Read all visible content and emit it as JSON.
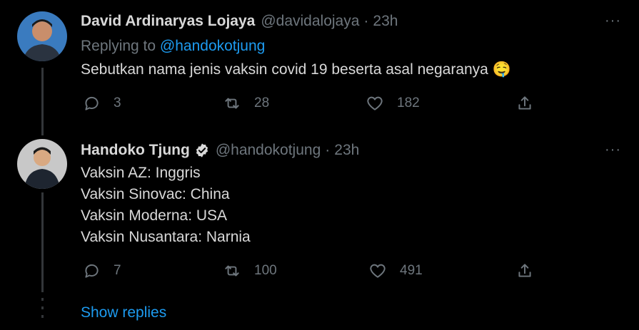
{
  "tweet1": {
    "name": "David Ardinaryas Lojaya",
    "handle": "@davidalojaya",
    "separator": "·",
    "time": "23h",
    "replying_prefix": "Replying to",
    "replying_handle": "@handokotjung",
    "text": "Sebutkan nama jenis vaksin covid 19 beserta asal negaranya",
    "emoji": "🤤",
    "replies": "3",
    "retweets": "28",
    "likes": "182",
    "more": "···"
  },
  "tweet2": {
    "name": "Handoko Tjung",
    "handle": "@handokotjung",
    "separator": "·",
    "time": "23h",
    "lines": [
      "Vaksin AZ: Inggris",
      "Vaksin Sinovac: China",
      "Vaksin Moderna: USA",
      "Vaksin Nusantara: Narnia"
    ],
    "replies": "7",
    "retweets": "100",
    "likes": "491",
    "more": "···"
  },
  "show_replies": "Show replies",
  "colors": {
    "background": "#000000",
    "text": "#d9d9d9",
    "muted": "#6e767d",
    "link": "#1d9bf0",
    "verified": "#d9d9d9"
  }
}
